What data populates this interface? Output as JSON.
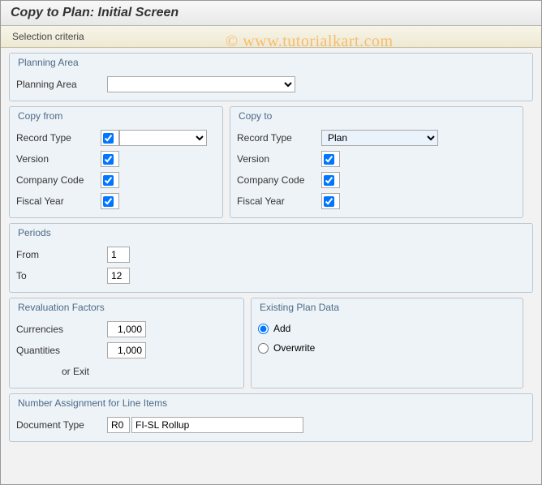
{
  "title": "Copy to Plan: Initial Screen",
  "toolbar_label": "Selection criteria",
  "watermark": "© www.tutorialkart.com",
  "planning_area": {
    "group_title": "Planning Area",
    "label": "Planning Area",
    "value": ""
  },
  "copy_from": {
    "group_title": "Copy from",
    "record_type_label": "Record Type",
    "record_type_value": "",
    "version_label": "Version",
    "version_checked": true,
    "company_code_label": "Company Code",
    "company_code_checked": true,
    "fiscal_year_label": "Fiscal Year",
    "fiscal_year_checked": true
  },
  "copy_to": {
    "group_title": "Copy to",
    "record_type_label": "Record Type",
    "record_type_value": "Plan",
    "version_label": "Version",
    "version_checked": true,
    "company_code_label": "Company Code",
    "company_code_checked": true,
    "fiscal_year_label": "Fiscal Year",
    "fiscal_year_checked": true
  },
  "periods": {
    "group_title": "Periods",
    "from_label": "From",
    "from_value": "1",
    "to_label": "To",
    "to_value": "12"
  },
  "reval": {
    "group_title": "Revaluation Factors",
    "currencies_label": "Currencies",
    "currencies_value": "1,000",
    "quantities_label": "Quantities",
    "quantities_value": "1,000",
    "or_exit_label": "or Exit"
  },
  "epd": {
    "group_title": "Existing Plan Data",
    "add_label": "Add",
    "overwrite_label": "Overwrite",
    "selected": "Add"
  },
  "number_assign": {
    "group_title": "Number Assignment for Line Items",
    "doc_type_label": "Document Type",
    "doc_type_code": "R0",
    "doc_type_desc": "FI-SL Rollup"
  }
}
